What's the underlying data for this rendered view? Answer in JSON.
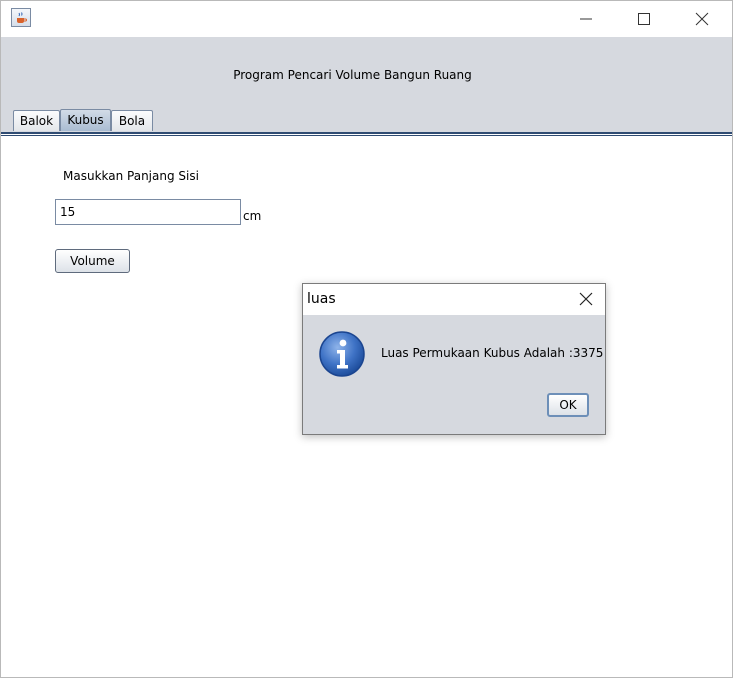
{
  "window": {
    "title_bar_icon": "java-coffee-icon",
    "controls": [
      "minimize-icon",
      "maximize-icon",
      "close-icon"
    ]
  },
  "header": {
    "title": "Program Pencari Volume Bangun Ruang"
  },
  "tabs": [
    {
      "label": "Balok",
      "selected": false
    },
    {
      "label": "Kubus",
      "selected": true
    },
    {
      "label": "Bola",
      "selected": false
    }
  ],
  "form": {
    "side_label": "Masukkan Panjang Sisi",
    "side_value": "15",
    "unit": "cm",
    "volume_button": "Volume"
  },
  "dialog": {
    "title": "luas",
    "icon": "info-icon",
    "message": "Luas Permukaan Kubus Adalah :3375",
    "ok_button": "OK"
  },
  "colors": {
    "panel_background": "#d6d9df",
    "tab_border": "#2f4b72",
    "info_icon_blue": "#2f63b8"
  }
}
